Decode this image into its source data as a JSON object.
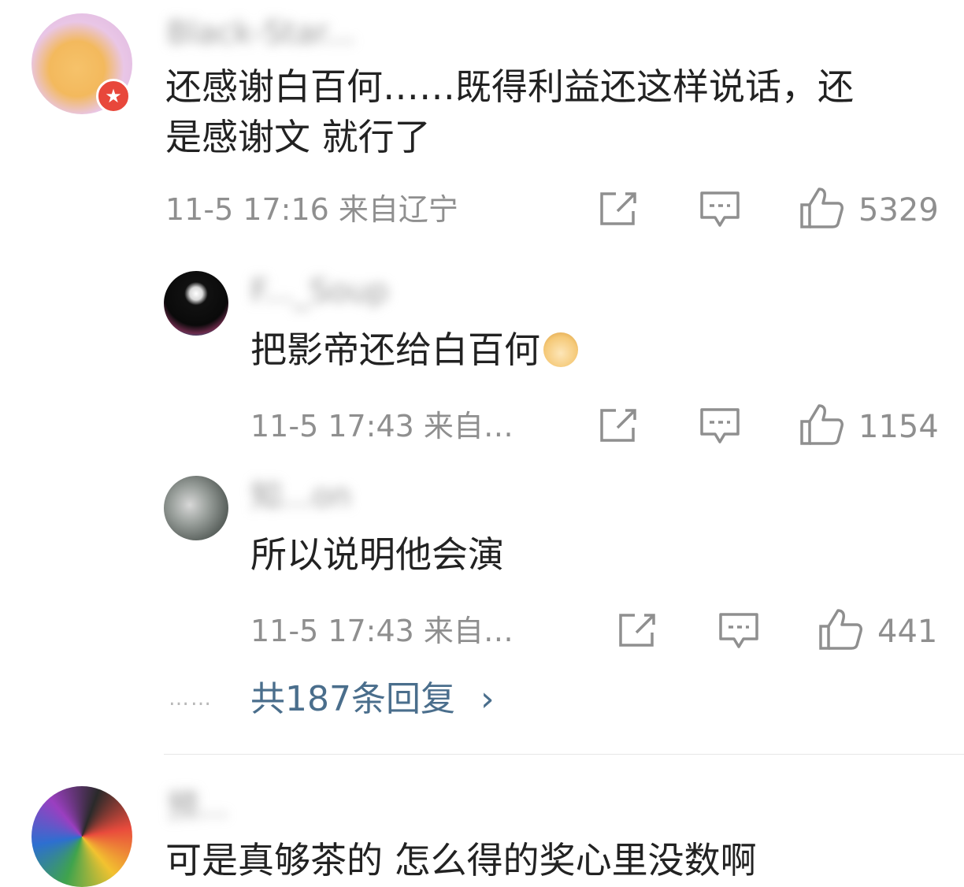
{
  "comments": [
    {
      "username": "Black-Star...",
      "text_line1": "还感谢白百何……既得利益还这样说话，还",
      "text_line2": "是感谢文 就行了",
      "meta": "11-5 17:16  来自辽宁",
      "likes": "5329"
    }
  ],
  "replies": [
    {
      "username": "F..._Soup",
      "text": "把影帝还给白百何",
      "emoji": "doge-emoji",
      "meta": "11-5 17:43  来自…",
      "likes": "1154"
    },
    {
      "username": "知...on",
      "text": "所以说明他会演",
      "meta": "11-5 17:43  来自…",
      "likes": "441"
    }
  ],
  "more_replies": {
    "dots": "……",
    "label": "共187条回复",
    "chevron": "›"
  },
  "next_comment": {
    "username": "预...",
    "text": "可是真够茶的 怎么得的奖心里没数啊"
  },
  "icons": {
    "share": "share-icon",
    "comment": "comment-icon",
    "like": "thumbs-up-icon"
  },
  "colors": {
    "link": "#4a6e8c",
    "meta": "#8f8f8f",
    "badge": "#e8473b"
  }
}
